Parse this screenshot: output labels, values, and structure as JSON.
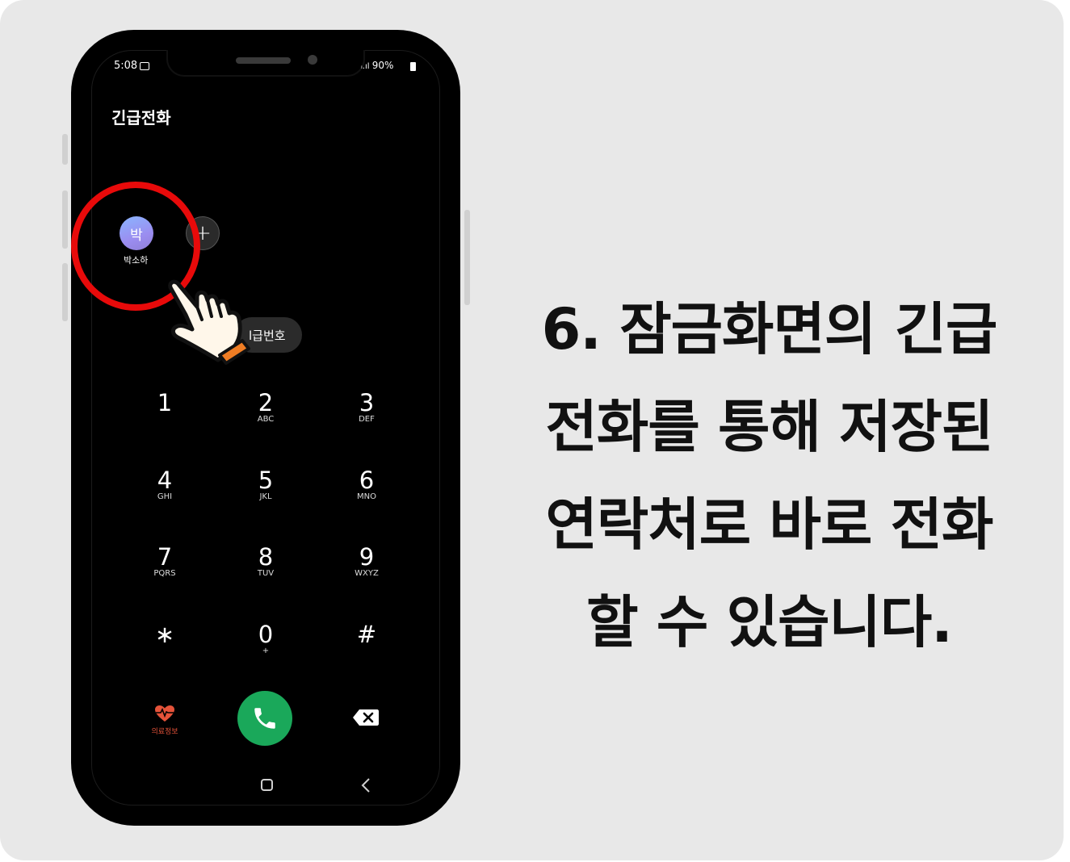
{
  "status_bar": {
    "time": "5:08",
    "signal_battery": "90%"
  },
  "screen": {
    "title": "긴급전화"
  },
  "contacts": [
    {
      "avatar_letter": "박",
      "name": "박소하"
    }
  ],
  "emergency_pill": "l급번호",
  "keypad": [
    {
      "digit": "1",
      "letters": ""
    },
    {
      "digit": "2",
      "letters": "ABC"
    },
    {
      "digit": "3",
      "letters": "DEF"
    },
    {
      "digit": "4",
      "letters": "GHI"
    },
    {
      "digit": "5",
      "letters": "JKL"
    },
    {
      "digit": "6",
      "letters": "MNO"
    },
    {
      "digit": "7",
      "letters": "PQRS"
    },
    {
      "digit": "8",
      "letters": "TUV"
    },
    {
      "digit": "9",
      "letters": "WXYZ"
    },
    {
      "digit": "∗",
      "letters": ""
    },
    {
      "digit": "0",
      "letters": "+"
    },
    {
      "digit": "#",
      "letters": ""
    }
  ],
  "bottom": {
    "medical_label": "의료정보"
  },
  "colors": {
    "highlight_ring": "#e80a0a",
    "call_button": "#1aa85a",
    "medical": "#e5533a",
    "background": "#e8e8e8"
  },
  "caption_lines": [
    "6. 잠금화면의 긴급",
    "전화를 통해 저장된",
    "연락처로 바로 전화",
    "할 수 있습니다."
  ]
}
